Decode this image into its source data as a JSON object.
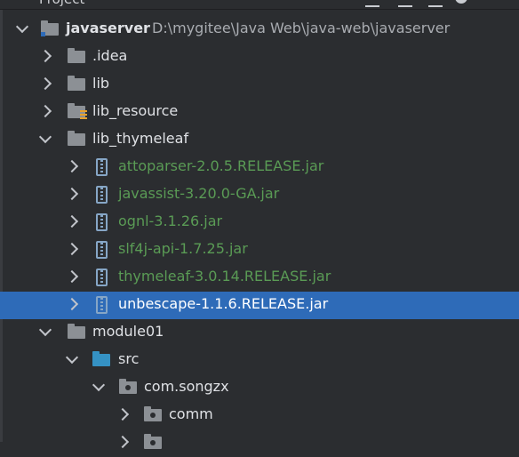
{
  "panel": {
    "title": "Project"
  },
  "tree": {
    "root": {
      "label": "javaserver",
      "path": "D:\\mygitee\\Java Web\\java-web\\javaserver"
    },
    "idea": {
      "label": ".idea"
    },
    "lib": {
      "label": "lib"
    },
    "lib_resource": {
      "label": "lib_resource"
    },
    "lib_thymeleaf": {
      "label": "lib_thymeleaf"
    },
    "jars": [
      {
        "label": "attoparser-2.0.5.RELEASE.jar"
      },
      {
        "label": "javassist-3.20.0-GA.jar"
      },
      {
        "label": "ognl-3.1.26.jar"
      },
      {
        "label": "slf4j-api-1.7.25.jar"
      },
      {
        "label": "thymeleaf-3.0.14.RELEASE.jar"
      },
      {
        "label": "unbescape-1.1.6.RELEASE.jar"
      }
    ],
    "module01": {
      "label": "module01"
    },
    "src": {
      "label": "src"
    },
    "pkg": {
      "label": "com.songzx"
    },
    "comm": {
      "label": "comm"
    }
  },
  "colors": {
    "selection": "#2e6bb8",
    "jar_text": "#5a9b55",
    "folder": "#8c9095",
    "source_folder": "#3592c4"
  },
  "icons": {
    "folder": "folder-icon",
    "jar": "jar-icon",
    "package": "package-icon",
    "source": "source-folder-icon"
  }
}
